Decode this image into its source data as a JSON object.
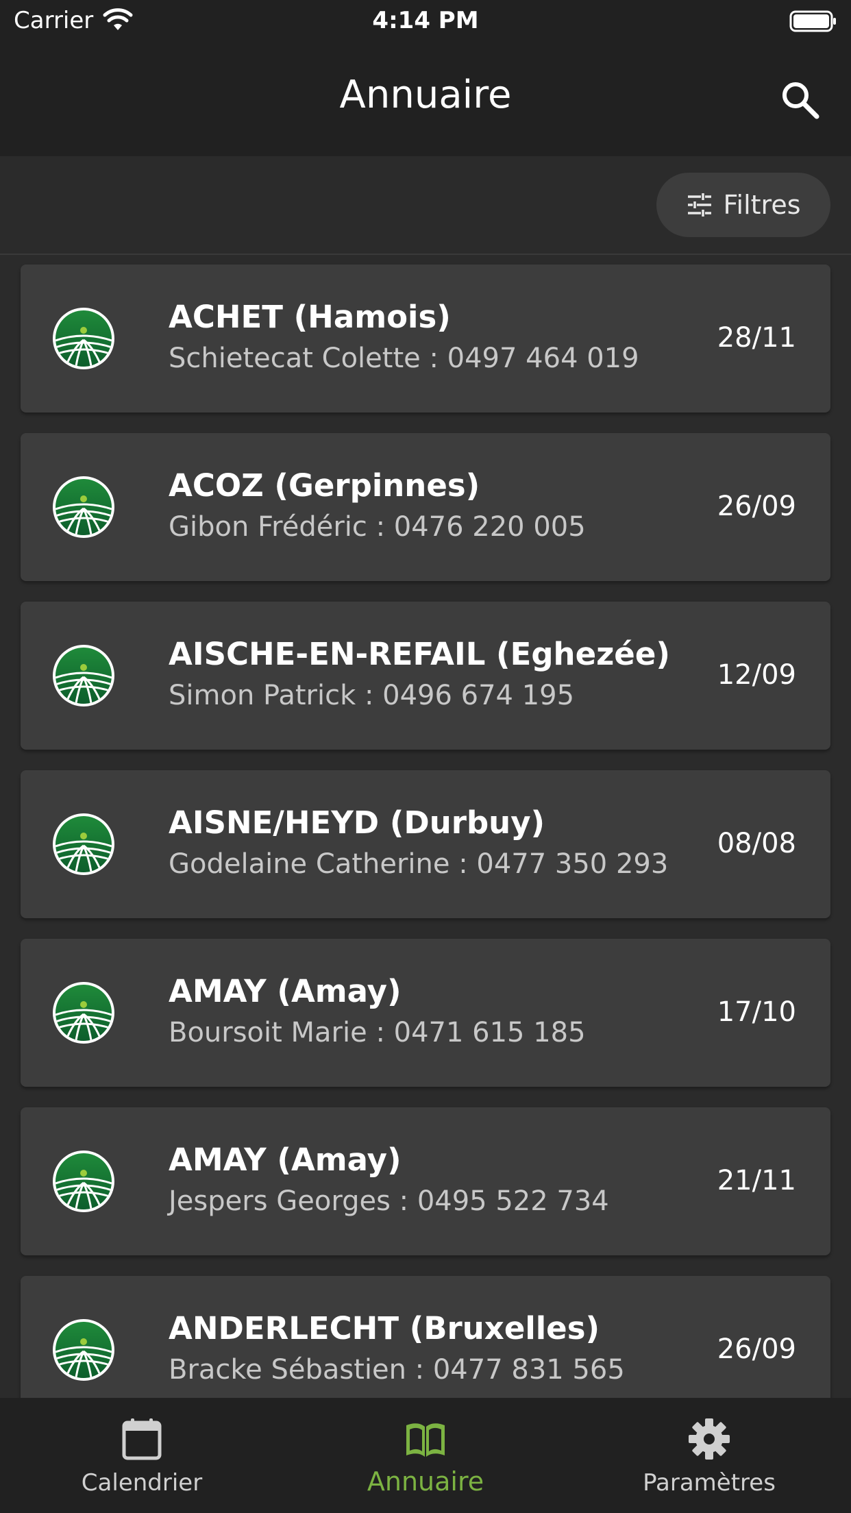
{
  "status_bar": {
    "carrier": "Carrier",
    "time": "4:14 PM",
    "wifi_icon": "wifi-icon",
    "battery_icon": "battery-icon"
  },
  "header": {
    "title": "Annuaire",
    "search_icon": "search-icon"
  },
  "filters": {
    "label": "Filtres",
    "icon": "sliders-icon"
  },
  "entries": [
    {
      "title": "ACHET (Hamois)",
      "contact": "Schietecat Colette : 0497 464 019",
      "date": "28/11"
    },
    {
      "title": "ACOZ (Gerpinnes)",
      "contact": "Gibon Frédéric : 0476 220 005",
      "date": "26/09"
    },
    {
      "title": "AISCHE-EN-REFAIL (Eghezée)",
      "contact": "Simon Patrick : 0496 674 195",
      "date": "12/09"
    },
    {
      "title": "AISNE/HEYD (Durbuy)",
      "contact": "Godelaine Catherine : 0477 350 293",
      "date": "08/08"
    },
    {
      "title": "AMAY (Amay)",
      "contact": "Boursoit Marie : 0471 615 185",
      "date": "17/10"
    },
    {
      "title": "AMAY (Amay)",
      "contact": "Jespers Georges : 0495 522 734",
      "date": "21/11"
    },
    {
      "title": "ANDERLECHT (Bruxelles)",
      "contact": "Bracke Sébastien : 0477 831 565",
      "date": "26/09"
    }
  ],
  "tabs": [
    {
      "label": "Calendrier",
      "icon": "calendar-icon",
      "active": false
    },
    {
      "label": "Annuaire",
      "icon": "book-icon",
      "active": true
    },
    {
      "label": "Paramètres",
      "icon": "gear-icon",
      "active": false
    }
  ],
  "colors": {
    "background": "#2b2b2b",
    "bar": "#212121",
    "card": "#3d3d3d",
    "accent": "#7cb342",
    "logo_green": "#2e9c3c"
  }
}
